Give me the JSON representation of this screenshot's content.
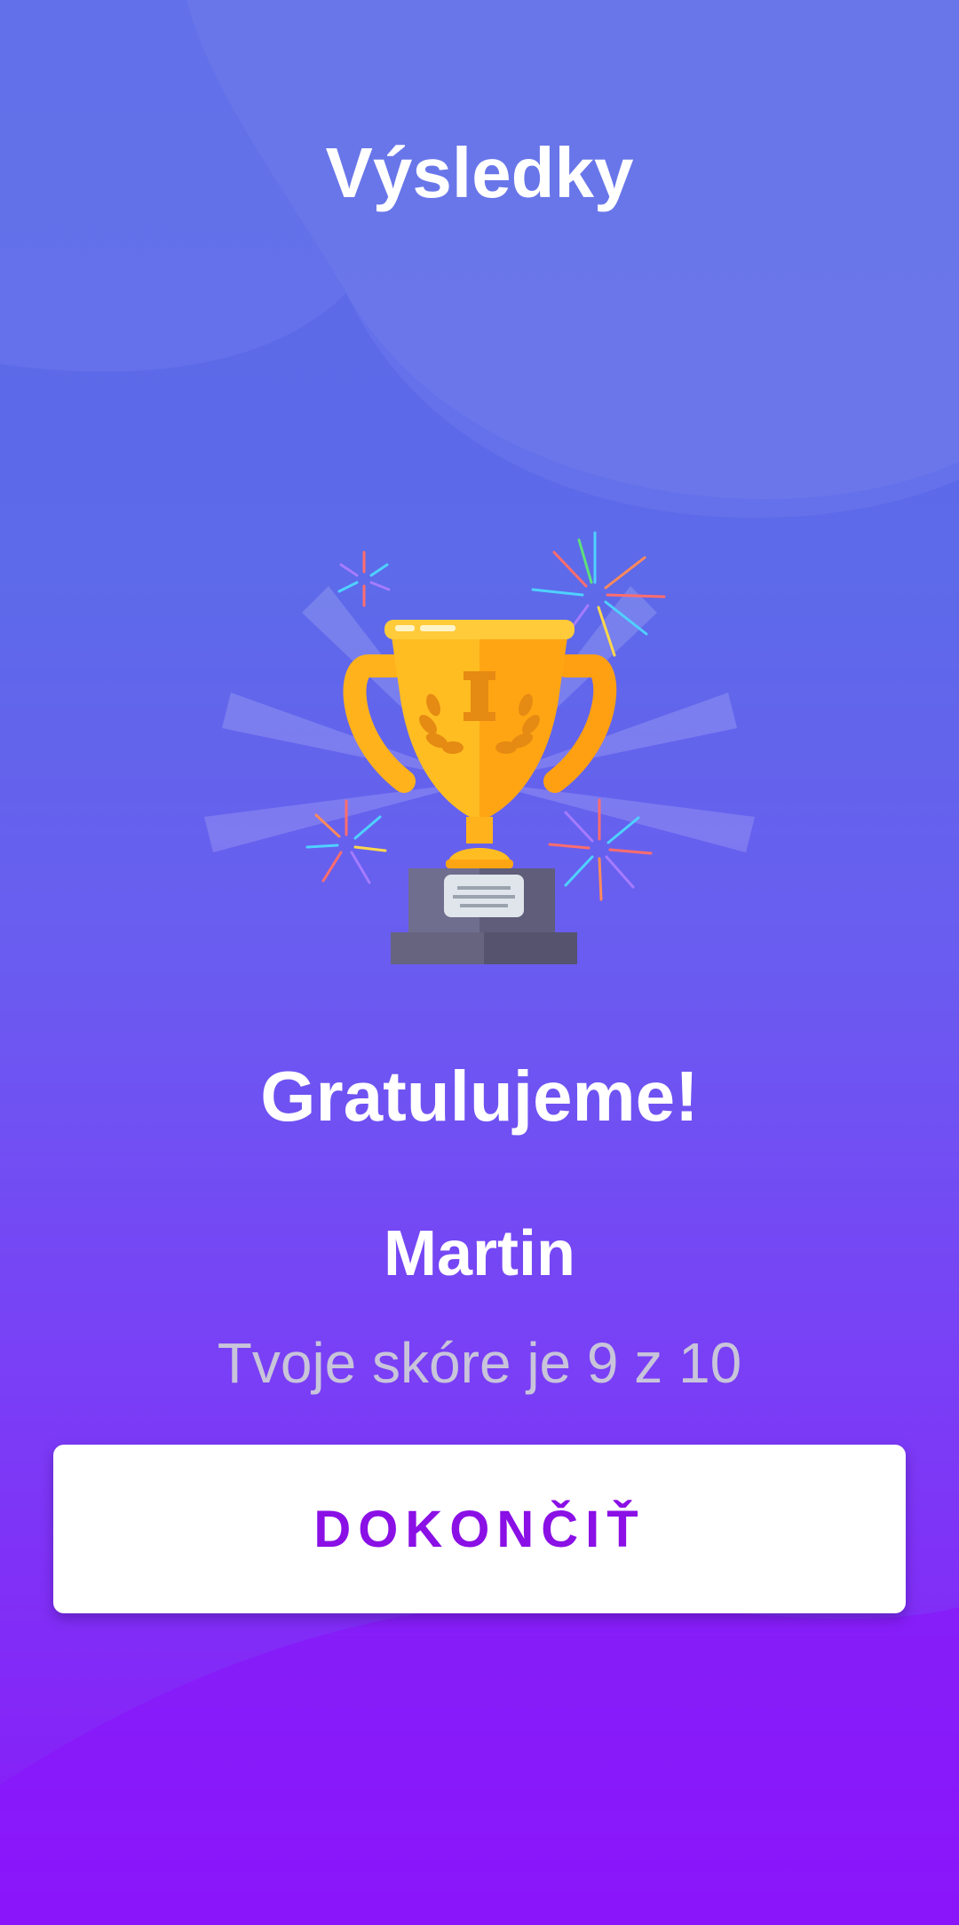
{
  "screen": {
    "title": "Výsledky",
    "congrats": "Gratulujeme!",
    "player_name": "Martin",
    "score_text": "Tvoje skóre je 9 z 10",
    "finish_button": "DOKONČIŤ"
  },
  "colors": {
    "background_top": "#5a6ae8",
    "background_bottom": "#8a18f8",
    "button_bg": "#ffffff",
    "button_text": "#8a10e6",
    "score_text": "#c8c4da",
    "trophy_gold": "#ffb81c",
    "trophy_base": "#5f5d7a"
  },
  "icons": {
    "hero": "trophy-icon",
    "decoration": "fireworks-icon"
  }
}
